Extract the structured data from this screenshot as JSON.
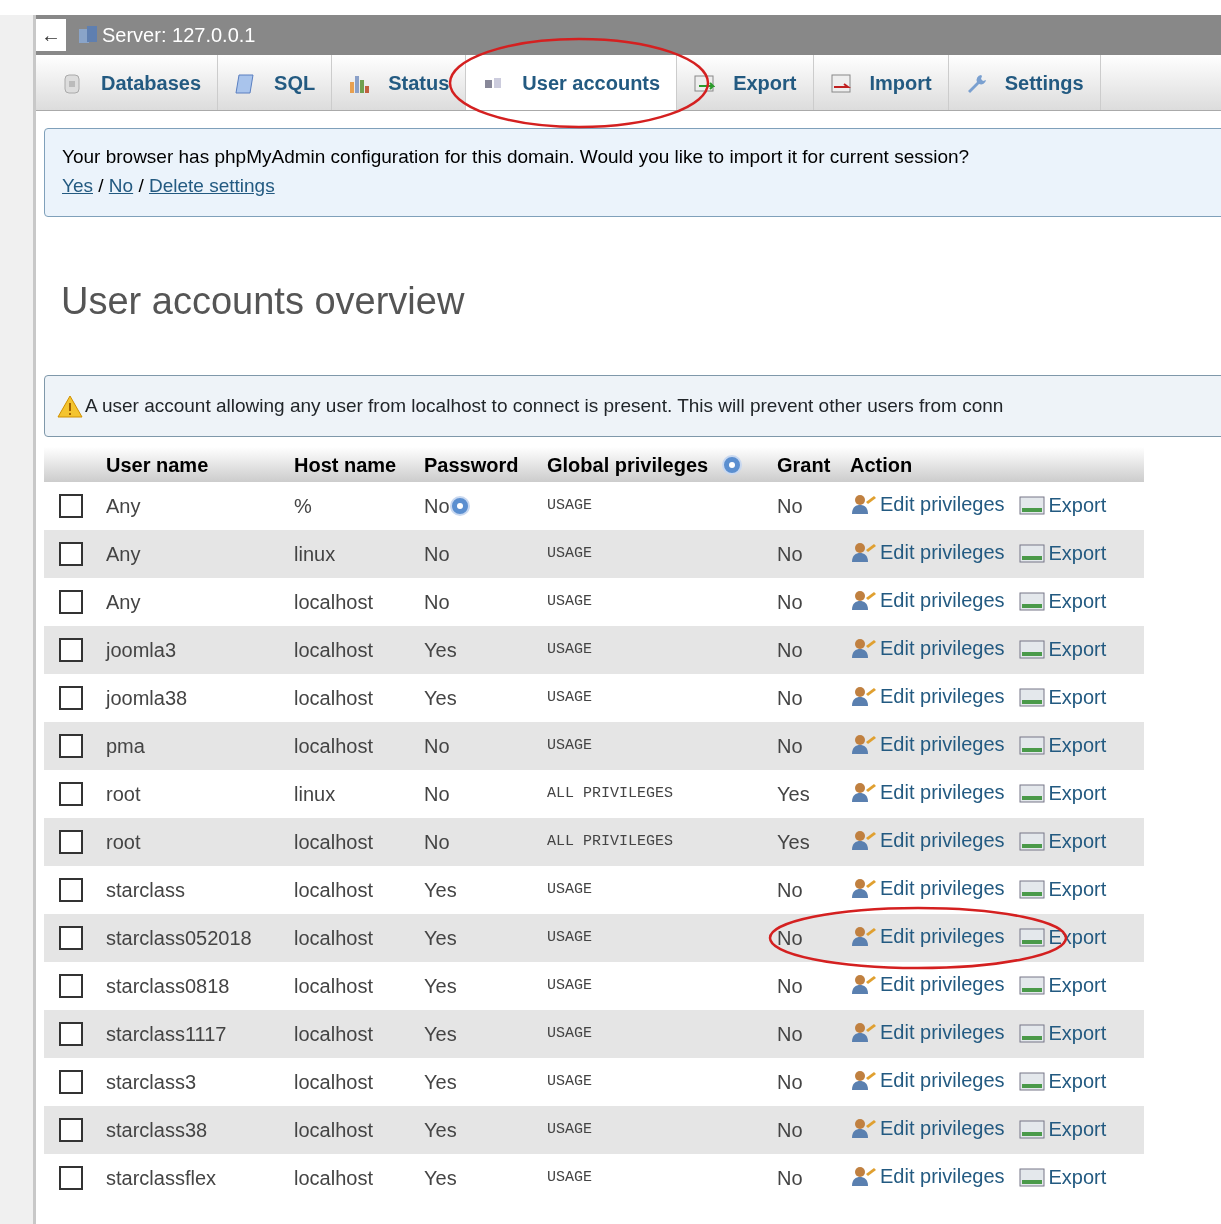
{
  "server_bar": {
    "back_label": "←",
    "title": "Server: 127.0.0.1"
  },
  "tabs": [
    {
      "kind": "databases",
      "label": "Databases",
      "selected": false,
      "circled": false
    },
    {
      "kind": "sql",
      "label": "SQL",
      "selected": false,
      "circled": false
    },
    {
      "kind": "status",
      "label": "Status",
      "selected": false,
      "circled": false
    },
    {
      "kind": "users",
      "label": "User accounts",
      "selected": true,
      "circled": true
    },
    {
      "kind": "export",
      "label": "Export",
      "selected": false,
      "circled": false
    },
    {
      "kind": "import",
      "label": "Import",
      "selected": false,
      "circled": false
    },
    {
      "kind": "settings",
      "label": "Settings",
      "selected": false,
      "circled": false
    }
  ],
  "config_notice": {
    "text": "Your browser has phpMyAdmin configuration for this domain. Would you like to import it for current session?",
    "links": [
      "Yes",
      "No",
      "Delete settings"
    ],
    "separator": "/"
  },
  "heading": "User accounts overview",
  "warning": {
    "text": "A user account allowing any user from localhost to connect is present. This will prevent other users from conn"
  },
  "table": {
    "columns": [
      {
        "label": "User name",
        "help": false
      },
      {
        "label": "Host name",
        "help": false
      },
      {
        "label": "Password",
        "help": false
      },
      {
        "label": "Global privileges",
        "help": true
      },
      {
        "label": "Grant",
        "help": false
      },
      {
        "label": "Action",
        "help": false
      }
    ],
    "rows": [
      {
        "user": "Any",
        "host": "%",
        "password": "No",
        "password_help": true,
        "privileges": "USAGE",
        "grant": "No",
        "edit": "Edit privileges",
        "export": "Export",
        "checked": false,
        "circled": false
      },
      {
        "user": "Any",
        "host": "linux",
        "password": "No",
        "password_help": false,
        "privileges": "USAGE",
        "grant": "No",
        "edit": "Edit privileges",
        "export": "Export",
        "checked": false,
        "circled": false
      },
      {
        "user": "Any",
        "host": "localhost",
        "password": "No",
        "password_help": false,
        "privileges": "USAGE",
        "grant": "No",
        "edit": "Edit privileges",
        "export": "Export",
        "checked": false,
        "circled": false
      },
      {
        "user": "joomla3",
        "host": "localhost",
        "password": "Yes",
        "password_help": false,
        "privileges": "USAGE",
        "grant": "No",
        "edit": "Edit privileges",
        "export": "Export",
        "checked": false,
        "circled": false
      },
      {
        "user": "joomla38",
        "host": "localhost",
        "password": "Yes",
        "password_help": false,
        "privileges": "USAGE",
        "grant": "No",
        "edit": "Edit privileges",
        "export": "Export",
        "checked": false,
        "circled": false
      },
      {
        "user": "pma",
        "host": "localhost",
        "password": "No",
        "password_help": false,
        "privileges": "USAGE",
        "grant": "No",
        "edit": "Edit privileges",
        "export": "Export",
        "checked": false,
        "circled": false
      },
      {
        "user": "root",
        "host": "linux",
        "password": "No",
        "password_help": false,
        "privileges": "ALL PRIVILEGES",
        "grant": "Yes",
        "edit": "Edit privileges",
        "export": "Export",
        "checked": false,
        "circled": false
      },
      {
        "user": "root",
        "host": "localhost",
        "password": "No",
        "password_help": false,
        "privileges": "ALL PRIVILEGES",
        "grant": "Yes",
        "edit": "Edit privileges",
        "export": "Export",
        "checked": false,
        "circled": false
      },
      {
        "user": "starclass",
        "host": "localhost",
        "password": "Yes",
        "password_help": false,
        "privileges": "USAGE",
        "grant": "No",
        "edit": "Edit privileges",
        "export": "Export",
        "checked": false,
        "circled": false
      },
      {
        "user": "starclass052018",
        "host": "localhost",
        "password": "Yes",
        "password_help": false,
        "privileges": "USAGE",
        "grant": "No",
        "edit": "Edit privileges",
        "export": "Export",
        "checked": false,
        "circled": true
      },
      {
        "user": "starclass0818",
        "host": "localhost",
        "password": "Yes",
        "password_help": false,
        "privileges": "USAGE",
        "grant": "No",
        "edit": "Edit privileges",
        "export": "Export",
        "checked": false,
        "circled": false
      },
      {
        "user": "starclass1117",
        "host": "localhost",
        "password": "Yes",
        "password_help": false,
        "privileges": "USAGE",
        "grant": "No",
        "edit": "Edit privileges",
        "export": "Export",
        "checked": false,
        "circled": false
      },
      {
        "user": "starclass3",
        "host": "localhost",
        "password": "Yes",
        "password_help": false,
        "privileges": "USAGE",
        "grant": "No",
        "edit": "Edit privileges",
        "export": "Export",
        "checked": false,
        "circled": false
      },
      {
        "user": "starclass38",
        "host": "localhost",
        "password": "Yes",
        "password_help": false,
        "privileges": "USAGE",
        "grant": "No",
        "edit": "Edit privileges",
        "export": "Export",
        "checked": false,
        "circled": false
      },
      {
        "user": "starclassflex",
        "host": "localhost",
        "password": "Yes",
        "password_help": false,
        "privileges": "USAGE",
        "grant": "No",
        "edit": "Edit privileges",
        "export": "Export",
        "checked": false,
        "circled": false
      }
    ]
  }
}
